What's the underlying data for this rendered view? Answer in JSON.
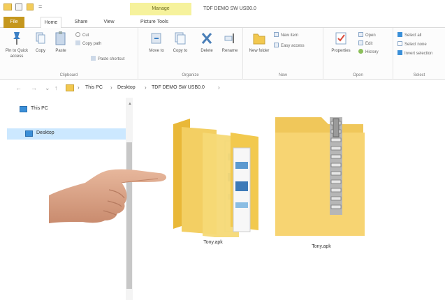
{
  "quick_access": {
    "separator": "="
  },
  "title_bar": {
    "contextual_tab": "Manage",
    "window_title": "TDF DEMO SW USB0.0"
  },
  "tabs": {
    "file": "File",
    "home": "Home",
    "share": "Share",
    "view": "View",
    "picture_tools": "Picture Tools"
  },
  "ribbon": {
    "clipboard": {
      "label": "Clipboard",
      "pin": "Pin to Quick access",
      "copy": "Copy",
      "paste": "Paste",
      "cut": "Cut",
      "copy_path": "Copy path",
      "paste_shortcut": "Paste shortcut"
    },
    "organize": {
      "label": "Organize",
      "move_to": "Move to",
      "copy_to": "Copy to",
      "delete": "Delete",
      "rename": "Rename"
    },
    "new": {
      "label": "New",
      "new_folder": "New folder",
      "new_item": "New item",
      "easy_access": "Easy access"
    },
    "open": {
      "label": "Open",
      "properties": "Properties",
      "open": "Open",
      "edit": "Edit",
      "history": "History"
    },
    "select": {
      "label": "Select",
      "select_all": "Select all",
      "select_none": "Select none",
      "invert_selection": "Invert selection"
    }
  },
  "address": {
    "back": "←",
    "forward": "→",
    "recent": "⌄",
    "up": "↑",
    "breadcrumbs": [
      "This PC",
      "Desktop",
      "TDF DEMO SW USB0.0"
    ],
    "separator": "›",
    "tail": "›"
  },
  "nav_pane": {
    "items": [
      {
        "label": "This PC"
      },
      {
        "label": "Desktop"
      }
    ],
    "scroll_up": "▲"
  },
  "content": {
    "items": [
      {
        "label": "Tony.apk",
        "icon": "folder-open-icon"
      },
      {
        "label": "Tony.apk",
        "icon": "zip-folder-icon"
      }
    ]
  },
  "colors": {
    "file_tab": "#c5971e",
    "contextual_tab": "#f6f29c",
    "selection": "#cce8ff",
    "folder": "#f2c84f"
  }
}
